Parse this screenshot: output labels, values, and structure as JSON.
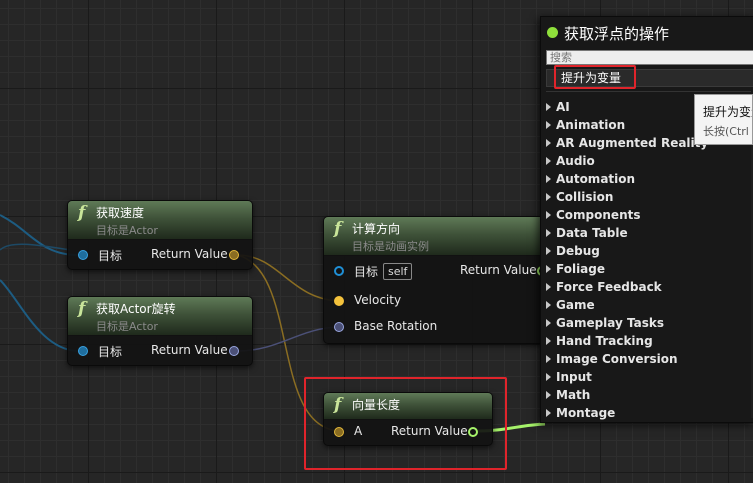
{
  "nodes": {
    "get_velocity": {
      "title": "获取速度",
      "subtitle": "目标是Actor",
      "target_label": "目标",
      "return_label": "Return Value"
    },
    "get_actor_rotation": {
      "title": "获取Actor旋转",
      "subtitle": "目标是Actor",
      "target_label": "目标",
      "return_label": "Return Value"
    },
    "calculate_direction": {
      "title": "计算方向",
      "subtitle": "目标是动画实例",
      "target_label": "目标",
      "self_tag": "self",
      "return_label": "Return Value",
      "velocity_label": "Velocity",
      "base_rotation_label": "Base Rotation"
    },
    "vector_length": {
      "title": "向量长度",
      "a_label": "A",
      "return_label": "Return Value"
    }
  },
  "menu": {
    "title": "获取浮点的操作",
    "search_placeholder": "搜索",
    "promote_label": "提升为变量",
    "categories": [
      "AI",
      "Animation",
      "AR Augmented Reality",
      "Audio",
      "Automation",
      "Collision",
      "Components",
      "Data Table",
      "Debug",
      "Foliage",
      "Force Feedback",
      "Game",
      "Gameplay Tasks",
      "Hand Tracking",
      "Image Conversion",
      "Input",
      "Math",
      "Montage"
    ]
  },
  "tooltip": {
    "line1": "提升为变量",
    "line2": "长按(Ctrl +"
  },
  "colors": {
    "vector_pin": "#e3b83b",
    "rotator_pin": "#9aa7e0",
    "object_pin": "#1f8fd6",
    "float_pin": "#a6f36a",
    "highlight": "#e0242b",
    "function_header": "#3f5239"
  },
  "icons": {
    "function": "function-f-icon",
    "submenu": "triangle-right-icon",
    "status": "green-dot-icon"
  }
}
